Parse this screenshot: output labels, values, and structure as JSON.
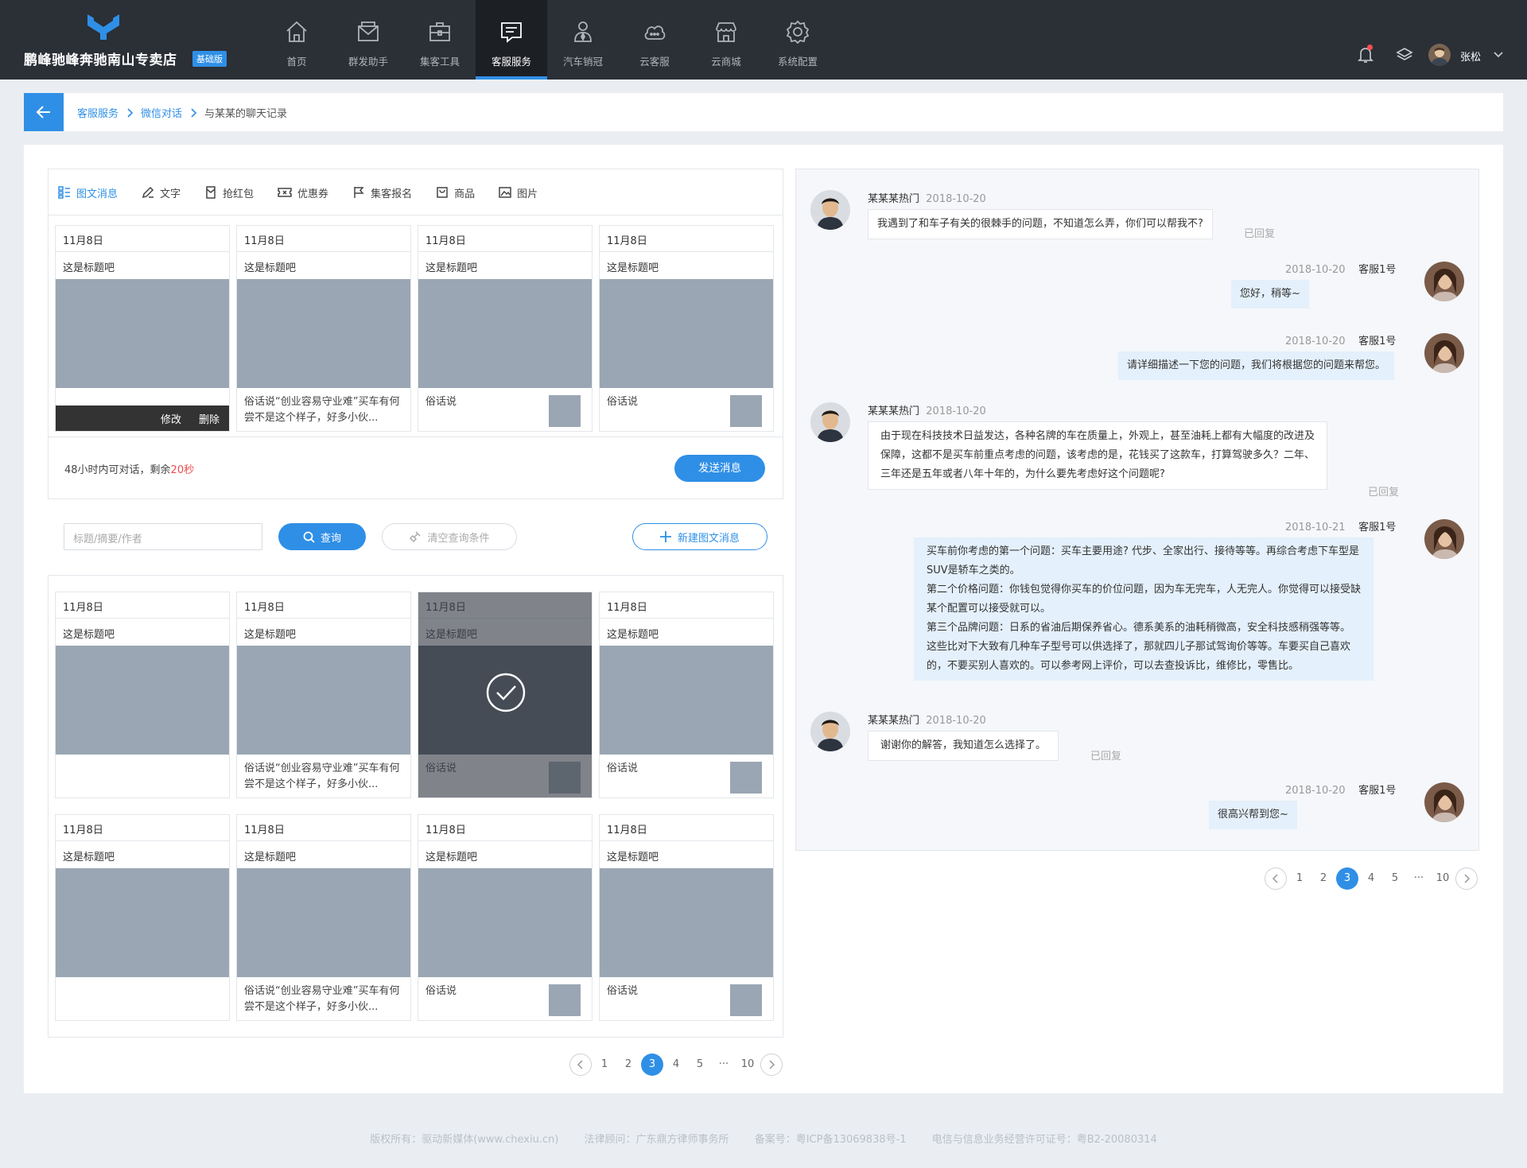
{
  "brand": {
    "name": "鹏峰驰峰奔驰南山专卖店",
    "badge": "基础版"
  },
  "nav": [
    {
      "label": "首页",
      "icon": "home-icon"
    },
    {
      "label": "群发助手",
      "icon": "mail-icon"
    },
    {
      "label": "集客工具",
      "icon": "briefcase-icon"
    },
    {
      "label": "客服服务",
      "icon": "message-icon",
      "active": true
    },
    {
      "label": "汽车销冠",
      "icon": "person-tie-icon"
    },
    {
      "label": "云客服",
      "icon": "cloud-chat-icon"
    },
    {
      "label": "云商城",
      "icon": "store-icon"
    },
    {
      "label": "系统配置",
      "icon": "gear-icon"
    }
  ],
  "user": {
    "name": "张松"
  },
  "breadcrumb": {
    "item1": "客服服务",
    "item2": "微信对话",
    "current": "与某某的聊天记录"
  },
  "tabs": [
    {
      "label": "图文消息",
      "icon": "grid-icon",
      "active": true
    },
    {
      "label": "文字",
      "icon": "pen-icon"
    },
    {
      "label": "抢红包",
      "icon": "redpacket-icon"
    },
    {
      "label": "优惠券",
      "icon": "coupon-icon"
    },
    {
      "label": "集客报名",
      "icon": "flag-icon"
    },
    {
      "label": "商品",
      "icon": "bag-icon"
    },
    {
      "label": "图片",
      "icon": "image-icon"
    }
  ],
  "card_text": {
    "date": "11月8日",
    "title": "这是标题吧",
    "long_caption": "俗话说“创业容易守业难”买车有何尝不是这个样子，好多小伙...",
    "short_caption": "俗话说",
    "edit": "修改",
    "delete": "删除"
  },
  "send": {
    "note_prefix": "48小时内可对话，剩余",
    "note_remaining": "20秒",
    "button": "发送消息"
  },
  "search": {
    "placeholder": "标题/摘要/作者",
    "query": "查询",
    "clear": "清空查询条件",
    "new": "新建图文消息"
  },
  "pager": {
    "pages": [
      "1",
      "2",
      "3",
      "4",
      "5",
      "···",
      "10"
    ],
    "current": "3"
  },
  "chat": {
    "customer_name": "某某某热门",
    "agent_name": "客服1号",
    "replied_label": "已回复",
    "messages": [
      {
        "from": "customer",
        "time": "2018-10-20",
        "lines": [
          "我遇到了和车子有关的很棘手的问题，不知道怎么弄，你们可以帮我不?"
        ]
      },
      {
        "from": "agent",
        "time": "2018-10-20",
        "lines": [
          "您好，稍等~"
        ]
      },
      {
        "from": "agent",
        "time": "2018-10-20",
        "lines": [
          "请详细描述一下您的问题，我们将根据您的问题来帮您。"
        ]
      },
      {
        "from": "customer",
        "time": "2018-10-20",
        "lines": [
          "由于现在科技技术日益发达，各种名牌的车在质量上，外观上，甚至油耗上都有大幅度的改进及",
          "保障，这都不是买车前重点考虑的问题，该考虑的是，花钱买了这款车，打算驾驶多久？二年、",
          "三年还是五年或者八年十年的，为什么要先考虑好这个问题呢?"
        ]
      },
      {
        "from": "agent",
        "time": "2018-10-21",
        "lines": [
          "买车前你考虑的第一个问题：买车主要用途? 代步、全家出行、接待等等。再综合考虑下车型是",
          "SUV是轿车之类的。",
          "第二个价格问题：你钱包觉得你买车的价位问题，因为车无完车，人无完人。你觉得可以接受缺",
          "某个配置可以接受就可以。",
          "第三个品牌问题：日系的省油后期保养省心。德系美系的油耗稍微高，安全科技感稍强等等。",
          "这些比对下大致有几种车子型号可以供选择了，那就四儿子那试驾询价等等。车要买自己喜欢",
          "的，不要买别人喜欢的。可以参考网上评价，可以去查投诉比，维修比，零售比。"
        ]
      },
      {
        "from": "customer",
        "time": "2018-10-20",
        "lines": [
          "谢谢你的解答，我知道怎么选择了。"
        ]
      },
      {
        "from": "agent",
        "time": "2018-10-20",
        "lines": [
          "很高兴帮到您~"
        ]
      }
    ]
  },
  "footer": {
    "copyright": "版权所有：驱动新媒体(www.chexiu.cn)",
    "legal": "法律顾问：广东鼎方律师事务所",
    "icp": "备案号：粤ICP备13069838号-1",
    "license": "电信与信息业务经营许可证号：粤B2-20080314"
  },
  "colors": {
    "accent": "#2f8fe6",
    "topbar": "#2b2f36",
    "placeholder_image": "#9aa6b3",
    "countdown": "#f04d4d"
  }
}
